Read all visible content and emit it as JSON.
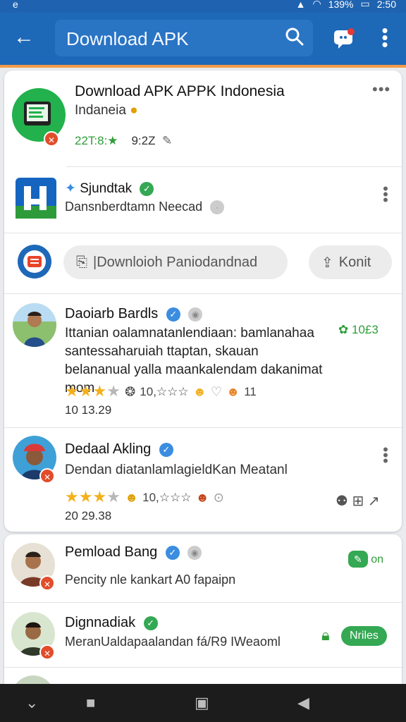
{
  "status": {
    "left": "e",
    "battery": "139%",
    "time": "2:50"
  },
  "appbar": {
    "search_text": "Download APK"
  },
  "app": {
    "title": "Download APK APPK Indonesia",
    "subtitle": "Indaneia",
    "stat_left": "22T:8:★",
    "stat_right": "9:2Z"
  },
  "dev": {
    "name": "Sjundtak",
    "sub": "Dansnberdtamn Neecad"
  },
  "actions": {
    "download_label": "|Downloioh Paniodandnad",
    "share_label": "Konit"
  },
  "reviews": [
    {
      "name": "Daoiarb Bardls",
      "text": "Ittanian oalamnatanlendiaan: bamlanahaa santessaharuiah ttaptan, skauan belananual yalla maankalendam dakanimat mom",
      "stars": 3,
      "meta": "10,☆☆☆",
      "count": "11",
      "date": "10 13.29",
      "side": "10£3"
    },
    {
      "name": "Dedaal Akling",
      "text": "Dendan diatanlamlagieldKan Meatanl",
      "stars": 3,
      "meta": "10,☆☆☆",
      "date": "20 29.38"
    }
  ],
  "list": [
    {
      "name": "Pemload Bang",
      "sub": "Pencity nle kankart A0 fapaipn",
      "badge": "on"
    },
    {
      "name": "Dignnadiak",
      "sub": "MeranUaldapaalandan fá/R9 IWeaoml",
      "badge": "Nriles"
    }
  ],
  "colors": {
    "appbar": "#1e68b8",
    "accent": "#f29a48",
    "green": "#34a853",
    "star": "#f3b01a"
  }
}
